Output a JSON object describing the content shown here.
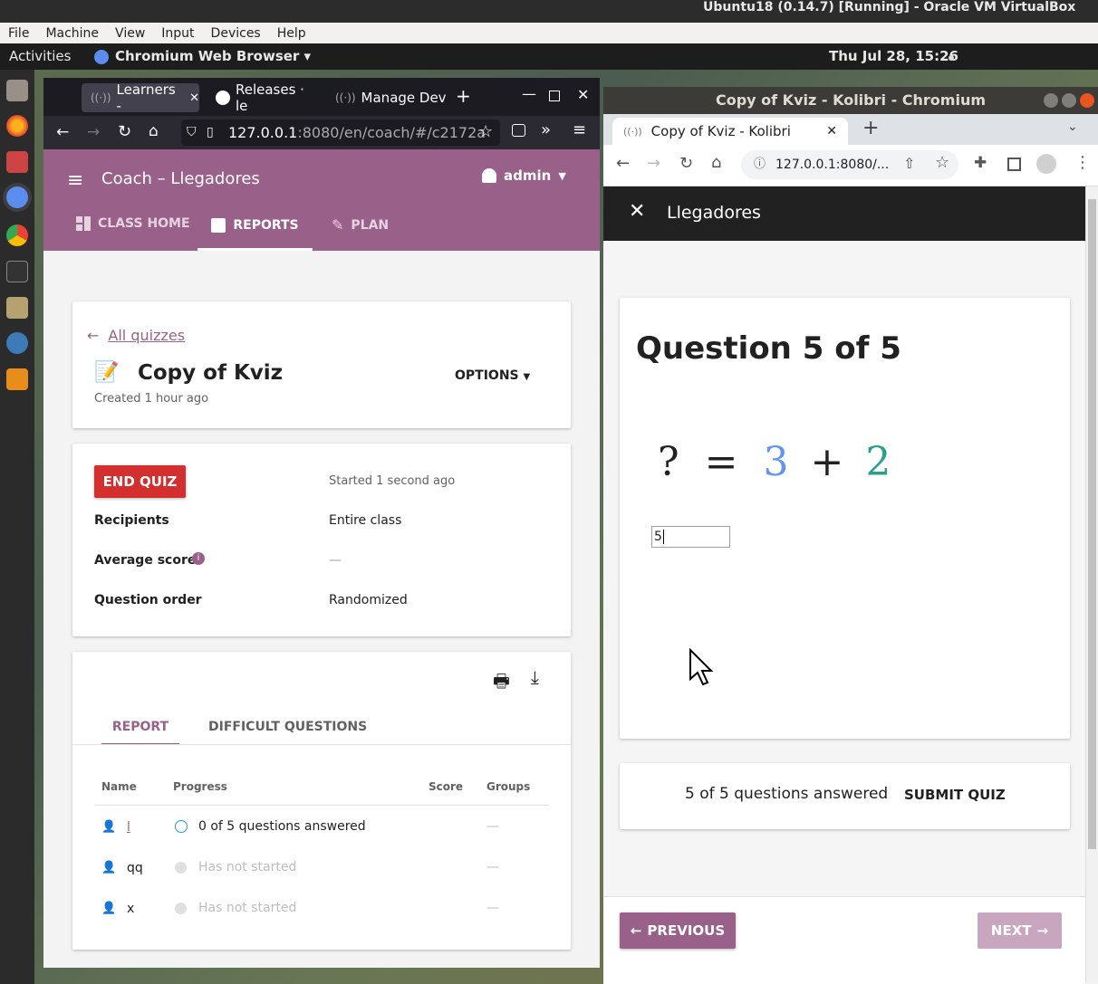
{
  "vbox": {
    "title": "Ubuntu18 (0.14.7) [Running] - Oracle VM VirtualBox",
    "menu": [
      "File",
      "Machine",
      "View",
      "Input",
      "Devices",
      "Help"
    ]
  },
  "gnome": {
    "activities": "Activities",
    "app": "Chromium Web Browser",
    "clock": "Thu Jul 28, 15:26"
  },
  "firefox": {
    "tabs": [
      "Learners -",
      "Releases · le",
      "Manage Dev"
    ],
    "url_host": "127.0.0.1",
    "url_rest": ":8080/en/coach/#/c2172a"
  },
  "coach": {
    "title": "Coach – Llegadores",
    "user": "admin",
    "nav": [
      "CLASS HOME",
      "REPORTS",
      "PLAN"
    ]
  },
  "quiz": {
    "back": "All quizzes",
    "title": "Copy of Kviz",
    "created": "Created 1 hour ago",
    "options": "OPTIONS"
  },
  "status": {
    "end_button": "END QUIZ",
    "started": "Started 1 second ago",
    "rows": [
      {
        "label": "Recipients",
        "value": "Entire class"
      },
      {
        "label": "Average score",
        "value": "—"
      },
      {
        "label": "Question order",
        "value": "Randomized"
      }
    ]
  },
  "report": {
    "tabs": [
      "REPORT",
      "DIFFICULT QUESTIONS"
    ],
    "headers": [
      "Name",
      "Progress",
      "Score",
      "Groups"
    ],
    "rows": [
      {
        "name": "l",
        "progress": "0 of 5 questions answered",
        "score": "",
        "groups": "—"
      },
      {
        "name": "qq",
        "progress": "Has not started",
        "score": "",
        "groups": "—"
      },
      {
        "name": "x",
        "progress": "Has not started",
        "score": "",
        "groups": "—"
      }
    ]
  },
  "chromium": {
    "title": "Copy of Kviz - Kolibri - Chromium",
    "tab": "Copy of Kviz - Kolibri",
    "url": "127.0.0.1:8080/..."
  },
  "learner": {
    "class": "Llegadores",
    "question_title": "Question 5 of 5",
    "eq_q": "?",
    "eq_eq": "=",
    "eq_a": "3",
    "eq_plus": "+",
    "eq_b": "2",
    "answer": "5",
    "answered": "5 of 5 questions answered",
    "submit": "SUBMIT QUIZ",
    "prev": "PREVIOUS",
    "next": "NEXT"
  },
  "colors": {
    "brand": "#996189",
    "danger": "#d32f2f",
    "eq_blue": "#6495ed",
    "eq_teal": "#28a08c"
  }
}
